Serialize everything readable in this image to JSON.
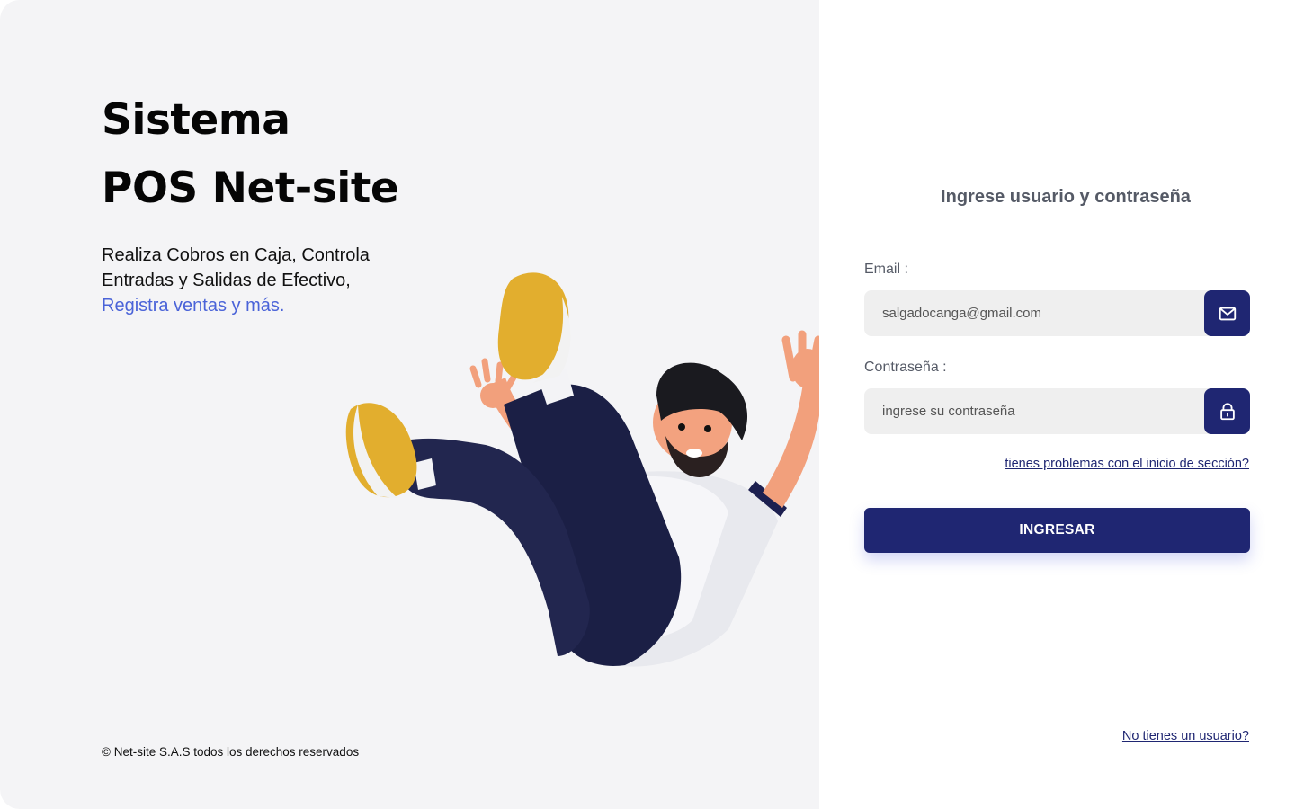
{
  "brand": {
    "title_line1": "Sistema",
    "title_line2": "POS Net-site",
    "tagline_part1": "Realiza Cobros en Caja, Controla Entradas y Salidas de Efectivo,",
    "tagline_highlight": "Registra ventas y más.",
    "copyright": "© Net-site S.A.S todos los derechos reservados"
  },
  "login": {
    "heading": "Ingrese usuario y contraseña",
    "email_label": "Email :",
    "email_value": "salgadocanga@gmail.com",
    "password_label": "Contraseña :",
    "password_placeholder": "ingrese su contraseña",
    "help_link": "tienes problemas con el inicio de sección?",
    "submit_label": "INGRESAR",
    "register_link": "No tienes un usuario?"
  },
  "icons": {
    "email": "envelope-icon",
    "password": "lock-icon"
  },
  "colors": {
    "primary": "#1f2672",
    "highlight": "#4a63d8",
    "left_background": "#f4f4f6",
    "input_background": "#efefef"
  }
}
